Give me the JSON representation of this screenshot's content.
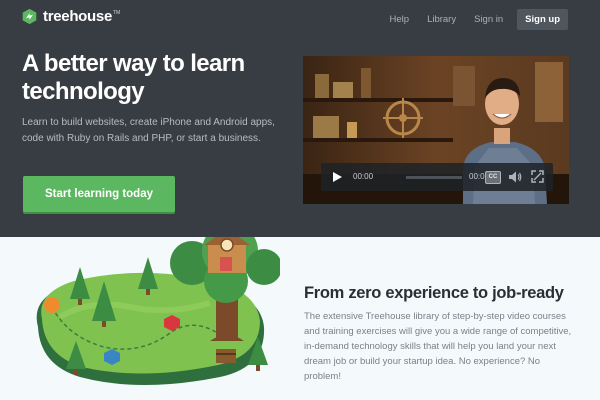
{
  "nav": {
    "brand": "treehouse",
    "trademark": "TM",
    "links": [
      "Help",
      "Library",
      "Sign in"
    ],
    "signup_label": "Sign up"
  },
  "hero": {
    "headline": "A better way to learn technology",
    "subtext": "Learn to build websites, create iPhone and Android apps, code with Ruby on Rails and PHP, or start a business.",
    "cta_label": "Start learning today"
  },
  "video": {
    "time_current": "00:00",
    "time_total": "00:00",
    "cc_label": "CC",
    "progress": 0
  },
  "section": {
    "title": "From zero experience to job-ready",
    "body": "The extensive Treehouse library of step-by-step video courses and training exercises will give you a wide range of competitive, in-demand technology skills that will help you land your next dream job or build your startup idea. No experience? No problem!"
  },
  "colors": {
    "hero_bg": "#383d43",
    "accent_green": "#5cb860",
    "lower_bg": "#f4f9fb"
  },
  "icons": [
    "treehouse-logo-icon",
    "play-icon",
    "volume-icon",
    "fullscreen-icon"
  ]
}
